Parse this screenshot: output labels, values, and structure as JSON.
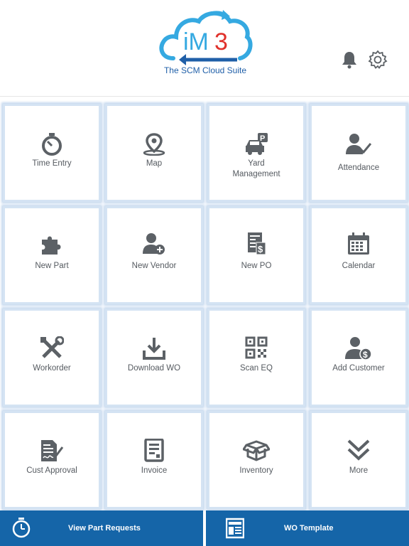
{
  "header": {
    "logo_text": "iM3",
    "tagline": "The SCM Cloud Suite",
    "bell_icon": "notification-bell-icon",
    "settings_icon": "gear-icon"
  },
  "tiles": [
    {
      "label": "Time Entry",
      "icon": "stopwatch-icon"
    },
    {
      "label": "Map",
      "icon": "map-pin-icon"
    },
    {
      "label": "Yard\nManagement",
      "icon": "parking-car-icon"
    },
    {
      "label": "Attendance",
      "icon": "user-check-icon"
    },
    {
      "label": "New Part",
      "icon": "puzzle-icon"
    },
    {
      "label": "New Vendor",
      "icon": "user-add-icon"
    },
    {
      "label": "New PO",
      "icon": "invoice-dollar-icon"
    },
    {
      "label": "Calendar",
      "icon": "calendar-icon"
    },
    {
      "label": "Workorder",
      "icon": "tools-icon"
    },
    {
      "label": "Download WO",
      "icon": "download-icon"
    },
    {
      "label": "Scan EQ",
      "icon": "qr-code-icon"
    },
    {
      "label": "Add Customer",
      "icon": "customer-dollar-icon"
    },
    {
      "label": "Cust Approval",
      "icon": "signed-document-icon"
    },
    {
      "label": "Invoice",
      "icon": "receipt-icon"
    },
    {
      "label": "Inventory",
      "icon": "open-box-icon"
    },
    {
      "label": "More",
      "icon": "double-chevron-down-icon"
    }
  ],
  "bottom": {
    "left_label": "View Part Requests",
    "left_icon": "stopwatch-icon",
    "right_label": "WO Template",
    "right_icon": "template-icon"
  },
  "colors": {
    "brand_blue": "#1565a8",
    "logo_cyan": "#35a9e1",
    "logo_red": "#e0312b",
    "icon_gray": "#5c6166",
    "tile_border": "#d4e3f3"
  }
}
